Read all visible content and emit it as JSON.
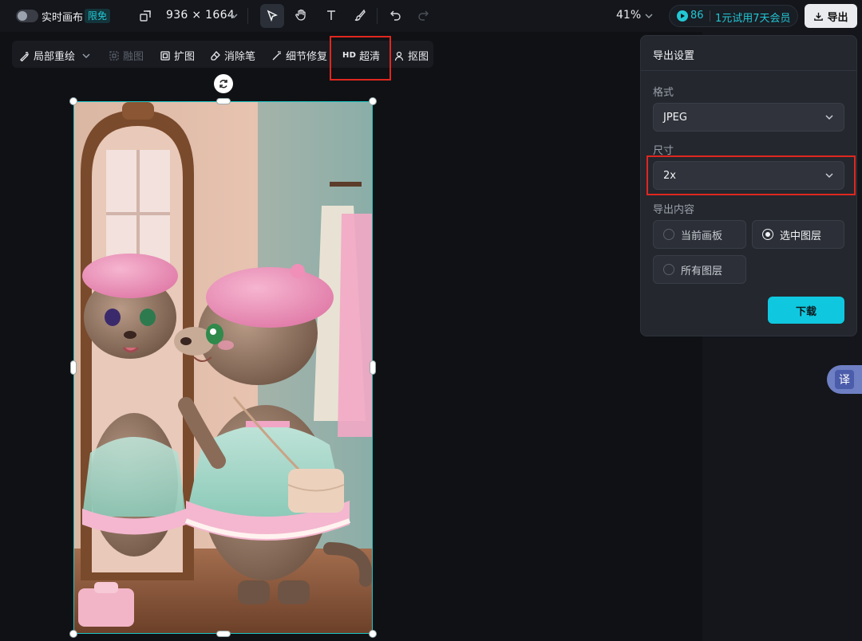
{
  "topbar": {
    "realtime_canvas_label": "实时画布",
    "limited_free_badge": "限免",
    "canvas_size": "936 × 1664",
    "zoom_level": "41%",
    "credits": "86",
    "promo": "1元试用7天会员",
    "export_label": "导出"
  },
  "subtoolbar": {
    "local_redraw": "局部重绘",
    "merge": "融图",
    "expand": "扩图",
    "eraser": "消除笔",
    "detail_fix": "细节修复",
    "hd_tag": "HD",
    "super_res": "超清",
    "cutout": "抠图"
  },
  "export_panel": {
    "title": "导出设置",
    "format_label": "格式",
    "format_value": "JPEG",
    "size_label": "尺寸",
    "size_value": "2x",
    "content_label": "导出内容",
    "options": [
      {
        "label": "当前画板",
        "selected": false
      },
      {
        "label": "选中图层",
        "selected": true
      },
      {
        "label": "所有图层",
        "selected": false
      }
    ],
    "download_label": "下载"
  },
  "side": {
    "translate_label": "译"
  },
  "colors": {
    "accent": "#0fc8e0",
    "highlight": "#e0271f",
    "selection": "#1cc6c6"
  }
}
